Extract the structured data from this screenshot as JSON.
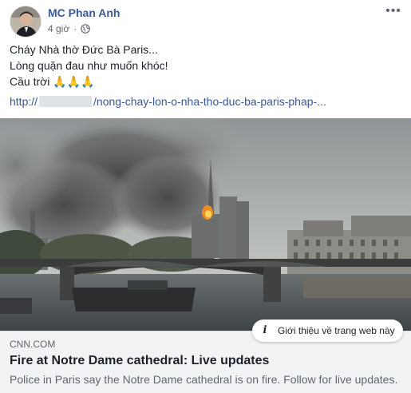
{
  "post": {
    "author": "MC Phan Anh",
    "time": "4 giờ",
    "separator": "·",
    "privacy_icon": "globe-icon",
    "more_icon": "ellipsis-icon",
    "lines": [
      "Cháy Nhà thờ Đức Bà Paris...",
      "Lòng quặn đau như muốn khóc!",
      "Cầu trời"
    ],
    "prayer_emojis": "🙏🙏🙏",
    "link_prefix": "http://",
    "link_suffix": "/nong-chay-lon-o-nha-tho-duc-ba-paris-phap-..."
  },
  "link_preview": {
    "image_alt_icon": "notre-dame-fire-photo",
    "domain": "CNN.COM",
    "title": "Fire at Notre Dame cathedral: Live updates",
    "description": "Police in Paris say the Notre Dame cathedral is on fire. Follow for live updates.",
    "info_button": "Giới thiệu về trang web này",
    "info_icon": "info-icon"
  },
  "colors": {
    "author": "#385898",
    "link": "#385898",
    "text": "#1d2129",
    "muted": "#606770",
    "caption_bg": "#f2f3f5"
  }
}
